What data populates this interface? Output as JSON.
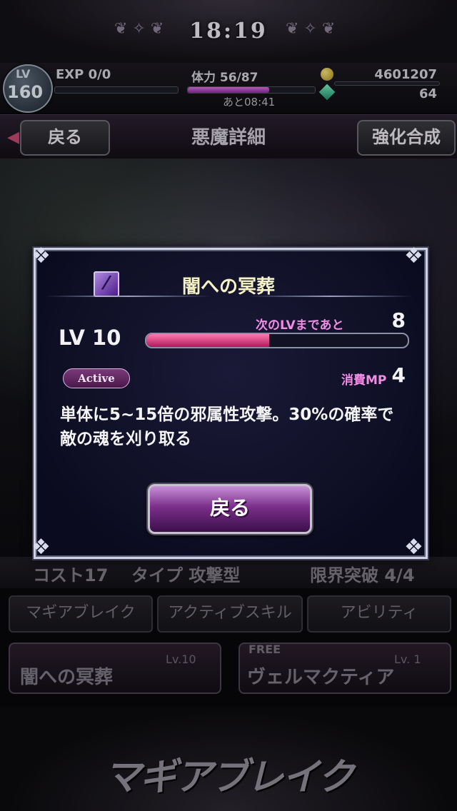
{
  "status": {
    "time": "18:19"
  },
  "player": {
    "lv_label": "LV",
    "lv_value": "160",
    "exp_label": "EXP 0/0",
    "stamina_label": "体力 56/87",
    "stamina_timer": "あと08:41",
    "coins": "4601207",
    "gems": "64",
    "stamina_fraction": 0.64
  },
  "nav": {
    "back_label": "戻る",
    "title": "悪魔詳細",
    "enhance_label": "強化合成"
  },
  "info_row": {
    "cost": "コスト17",
    "type": "タイプ 攻撃型",
    "limit_break": "限界突破 4/4"
  },
  "tabs": [
    {
      "label": "マギアブレイク"
    },
    {
      "label": "アクティブスキル"
    },
    {
      "label": "アビリティ"
    }
  ],
  "skill_cards": [
    {
      "name": "闇への冥葬",
      "level": "Lv.10"
    },
    {
      "name": "ヴェルマクティア",
      "level": "Lv.  1",
      "tag": "FREE"
    }
  ],
  "logo": "マギアブレイク",
  "dialog": {
    "skill_name": "闇への冥葬",
    "level_text": "LV 10",
    "next_lv_label": "次のLVまであと",
    "next_lv_value": "8",
    "exp_fraction": 0.47,
    "type_badge": "Active",
    "mp_label": "消費MP",
    "mp_value": "4",
    "description": "単体に5~15倍の邪属性攻撃。30%の確率で敵の魂を刈り取る",
    "back_button": "戻る"
  },
  "colors": {
    "dialog_bg": "#0b0b1f",
    "accent_pink": "#f08ee6",
    "button_purple": "#7a2f8a",
    "title_yellow": "#f5f2c6"
  }
}
